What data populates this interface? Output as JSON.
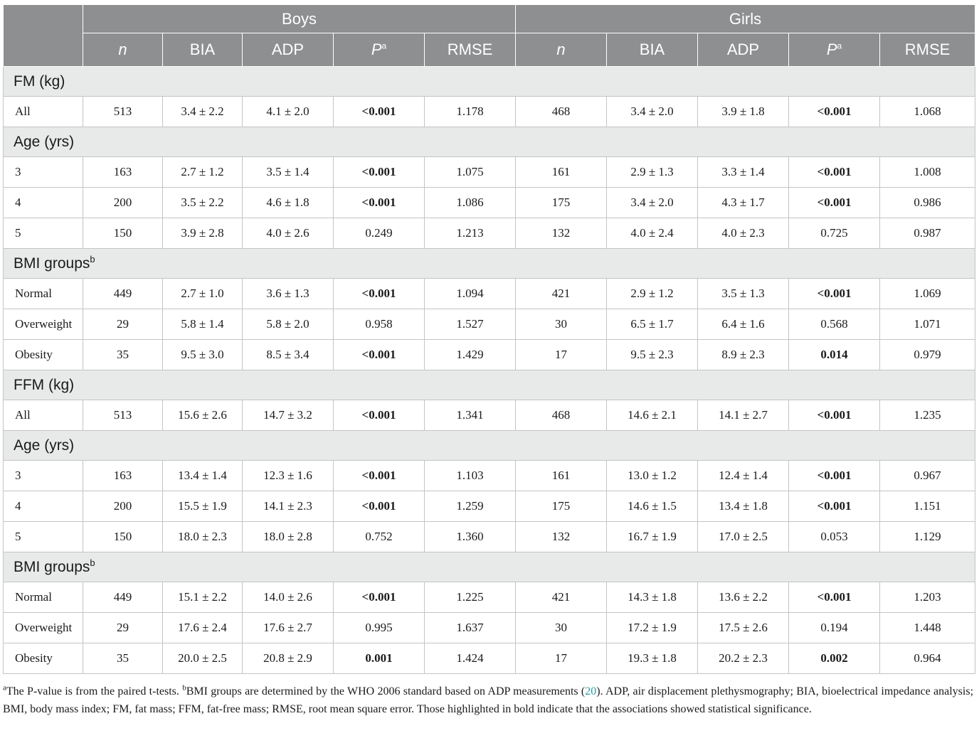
{
  "header": {
    "boys": "Boys",
    "girls": "Girls",
    "col_n": "n",
    "col_bia": "BIA",
    "col_adp": "ADP",
    "col_p": "P",
    "col_p_sup": "a",
    "col_rmse": "RMSE"
  },
  "sections": {
    "fm": "FM (kg)",
    "age1": "Age (yrs)",
    "bmi1": "BMI groups",
    "bmi1_sup": "b",
    "ffm": "FFM (kg)",
    "age2": "Age (yrs)",
    "bmi2": "BMI groups",
    "bmi2_sup": "b"
  },
  "rows": [
    [
      "All",
      "513",
      "3.4 ± 2.2",
      "4.1 ± 2.0",
      "<0.001",
      "1.178",
      "468",
      "3.4 ± 2.0",
      "3.9 ± 1.8",
      "<0.001",
      "1.068"
    ],
    [
      "3",
      "163",
      "2.7 ± 1.2",
      "3.5 ± 1.4",
      "<0.001",
      "1.075",
      "161",
      "2.9 ± 1.3",
      "3.3 ± 1.4",
      "<0.001",
      "1.008"
    ],
    [
      "4",
      "200",
      "3.5 ± 2.2",
      "4.6 ± 1.8",
      "<0.001",
      "1.086",
      "175",
      "3.4 ± 2.0",
      "4.3 ± 1.7",
      "<0.001",
      "0.986"
    ],
    [
      "5",
      "150",
      "3.9 ± 2.8",
      "4.0 ± 2.6",
      "0.249",
      "1.213",
      "132",
      "4.0 ± 2.4",
      "4.0 ± 2.3",
      "0.725",
      "0.987"
    ],
    [
      "Normal",
      "449",
      "2.7 ± 1.0",
      "3.6 ± 1.3",
      "<0.001",
      "1.094",
      "421",
      "2.9 ± 1.2",
      "3.5 ± 1.3",
      "<0.001",
      "1.069"
    ],
    [
      "Overweight",
      "29",
      "5.8 ± 1.4",
      "5.8 ± 2.0",
      "0.958",
      "1.527",
      "30",
      "6.5 ± 1.7",
      "6.4 ± 1.6",
      "0.568",
      "1.071"
    ],
    [
      "Obesity",
      "35",
      "9.5 ± 3.0",
      "8.5 ± 3.4",
      "<0.001",
      "1.429",
      "17",
      "9.5 ± 2.3",
      "8.9 ± 2.3",
      "0.014",
      "0.979"
    ],
    [
      "All",
      "513",
      "15.6 ± 2.6",
      "14.7 ± 3.2",
      "<0.001",
      "1.341",
      "468",
      "14.6 ± 2.1",
      "14.1 ± 2.7",
      "<0.001",
      "1.235"
    ],
    [
      "3",
      "163",
      "13.4 ± 1.4",
      "12.3 ± 1.6",
      "<0.001",
      "1.103",
      "161",
      "13.0 ± 1.2",
      "12.4 ± 1.4",
      "<0.001",
      "0.967"
    ],
    [
      "4",
      "200",
      "15.5 ± 1.9",
      "14.1 ± 2.3",
      "<0.001",
      "1.259",
      "175",
      "14.6 ± 1.5",
      "13.4 ± 1.8",
      "<0.001",
      "1.151"
    ],
    [
      "5",
      "150",
      "18.0 ± 2.3",
      "18.0 ± 2.8",
      "0.752",
      "1.360",
      "132",
      "16.7 ± 1.9",
      "17.0 ± 2.5",
      "0.053",
      "1.129"
    ],
    [
      "Normal",
      "449",
      "15.1 ± 2.2",
      "14.0 ± 2.6",
      "<0.001",
      "1.225",
      "421",
      "14.3 ± 1.8",
      "13.6 ± 2.2",
      "<0.001",
      "1.203"
    ],
    [
      "Overweight",
      "29",
      "17.6 ± 2.4",
      "17.6 ± 2.7",
      "0.995",
      "1.637",
      "30",
      "17.2 ± 1.9",
      "17.5 ± 2.6",
      "0.194",
      "1.448"
    ],
    [
      "Obesity",
      "35",
      "20.0 ± 2.5",
      "20.8 ± 2.9",
      "0.001",
      "1.424",
      "17",
      "19.3 ± 1.8",
      "20.2 ± 2.3",
      "0.002",
      "0.964"
    ]
  ],
  "bold_cells": [
    [
      0,
      4
    ],
    [
      0,
      9
    ],
    [
      1,
      4
    ],
    [
      1,
      9
    ],
    [
      2,
      4
    ],
    [
      2,
      9
    ],
    [
      4,
      4
    ],
    [
      4,
      9
    ],
    [
      6,
      4
    ],
    [
      6,
      9
    ],
    [
      7,
      4
    ],
    [
      7,
      9
    ],
    [
      8,
      4
    ],
    [
      8,
      9
    ],
    [
      9,
      4
    ],
    [
      9,
      9
    ],
    [
      11,
      4
    ],
    [
      11,
      9
    ],
    [
      13,
      4
    ],
    [
      13,
      9
    ]
  ],
  "footnote": {
    "sup_a": "a",
    "text_a": "The P-value is from the paired t-tests. ",
    "sup_b": "b",
    "text_b": "BMI groups are determined by the WHO 2006 standard based on ADP measurements (",
    "ref": "20",
    "text_c": "). ADP, air displacement plethysmography; BIA, bioelectrical impedance analysis; BMI, body mass index; FM, fat mass; FFM, fat-free mass; RMSE, root mean square error. Those highlighted in bold indicate that the associations showed statistical significance."
  }
}
